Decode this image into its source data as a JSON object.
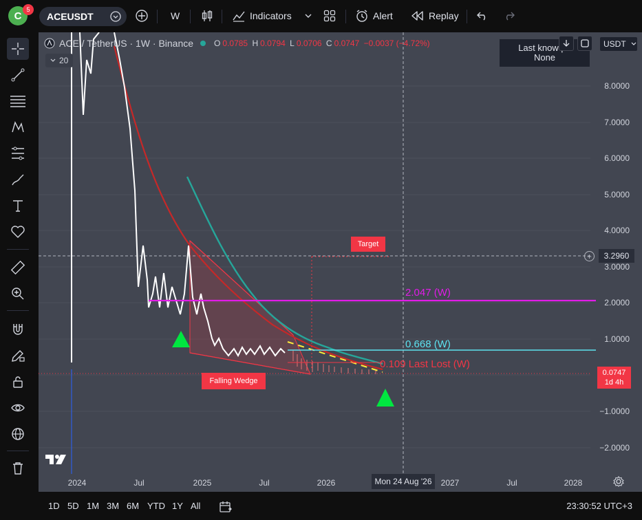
{
  "topbar": {
    "avatar_letter": "C",
    "notification_count": "5",
    "symbol": "ACEUSDT",
    "interval": "W",
    "indicators_label": "Indicators",
    "alert_label": "Alert",
    "replay_label": "Replay"
  },
  "legend": {
    "title": "ACE / TetherUS · 1W · Binance",
    "o_label": "O",
    "o_value": "0.0785",
    "h_label": "H",
    "h_value": "0.0794",
    "l_label": "L",
    "l_value": "0.0706",
    "c_label": "C",
    "c_value": "0.0747",
    "change": "−0.0037 (−4.72%)",
    "volume_value": "20"
  },
  "tooltip": {
    "line1": "Last know pa",
    "line2": "None"
  },
  "currency": "USDT",
  "price_scale": [
    "8.0000",
    "7.0000",
    "6.0000",
    "5.0000",
    "4.0000",
    "3.0000",
    "2.0000",
    "1.0000",
    "0.0000",
    "−1.0000",
    "−2.0000"
  ],
  "crosshair": {
    "price": "3.2960",
    "time": "Mon 24 Aug '26"
  },
  "current_price": {
    "value": "0.0747",
    "countdown": "1d 4h"
  },
  "time_axis": [
    "2024",
    "Jul",
    "2025",
    "Jul",
    "2026",
    "2027",
    "Jul",
    "2028"
  ],
  "annotations": {
    "target": "Target",
    "falling_wedge": "Falling Wedge",
    "level_2047": "2.047 (W)",
    "level_0668": "0.668 (W)",
    "level_last_lost": "0.109 Last Lost (W)"
  },
  "colors": {
    "level_2047": "#e21ce8",
    "level_0668": "#5de3f0",
    "level_last_lost": "#f23645",
    "ema_teal": "#26a69a",
    "ema_red": "#d32f2f",
    "arrow_green": "#00e640"
  },
  "ranges": [
    "1D",
    "5D",
    "1M",
    "3M",
    "6M",
    "YTD",
    "1Y",
    "All"
  ],
  "clock": "23:30:52 UTC+3"
}
